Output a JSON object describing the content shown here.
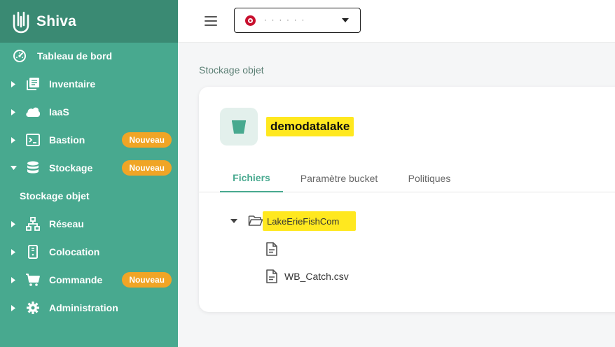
{
  "brand": {
    "name": "Shiva"
  },
  "colors": {
    "sidebar": "#48a98f",
    "sidebar_header": "#3a8a73",
    "badge": "#f0a526",
    "highlight": "#ffe81f",
    "accent": "#48a98f"
  },
  "sidebar": {
    "dashboard": {
      "label": "Tableau de bord",
      "icon": "gauge-icon"
    },
    "items": [
      {
        "label": "Inventaire",
        "icon": "library-icon",
        "badge": ""
      },
      {
        "label": "IaaS",
        "icon": "cloud-icon",
        "badge": ""
      },
      {
        "label": "Bastion",
        "icon": "terminal-icon",
        "badge": "Nouveau"
      },
      {
        "label": "Stockage",
        "icon": "database-icon",
        "badge": "Nouveau"
      },
      {
        "label": "Réseau",
        "icon": "network-icon",
        "badge": ""
      },
      {
        "label": "Colocation",
        "icon": "server-icon",
        "badge": ""
      },
      {
        "label": "Commande",
        "icon": "cart-icon",
        "badge": "Nouveau"
      },
      {
        "label": "Administration",
        "icon": "gear-icon",
        "badge": ""
      }
    ],
    "subitem": {
      "label": "Stockage objet"
    }
  },
  "topbar": {
    "org_name": "· · ·  ·  ·  ·"
  },
  "main": {
    "page_title": "Stockage objet",
    "bucket_name": "demodatalake",
    "tabs": [
      "Fichiers",
      "Paramètre bucket",
      "Politiques"
    ],
    "active_tab": "Fichiers",
    "tree": {
      "folder": "LakeErieFishCom",
      "files": [
        "",
        "WB_Catch.csv"
      ]
    }
  }
}
